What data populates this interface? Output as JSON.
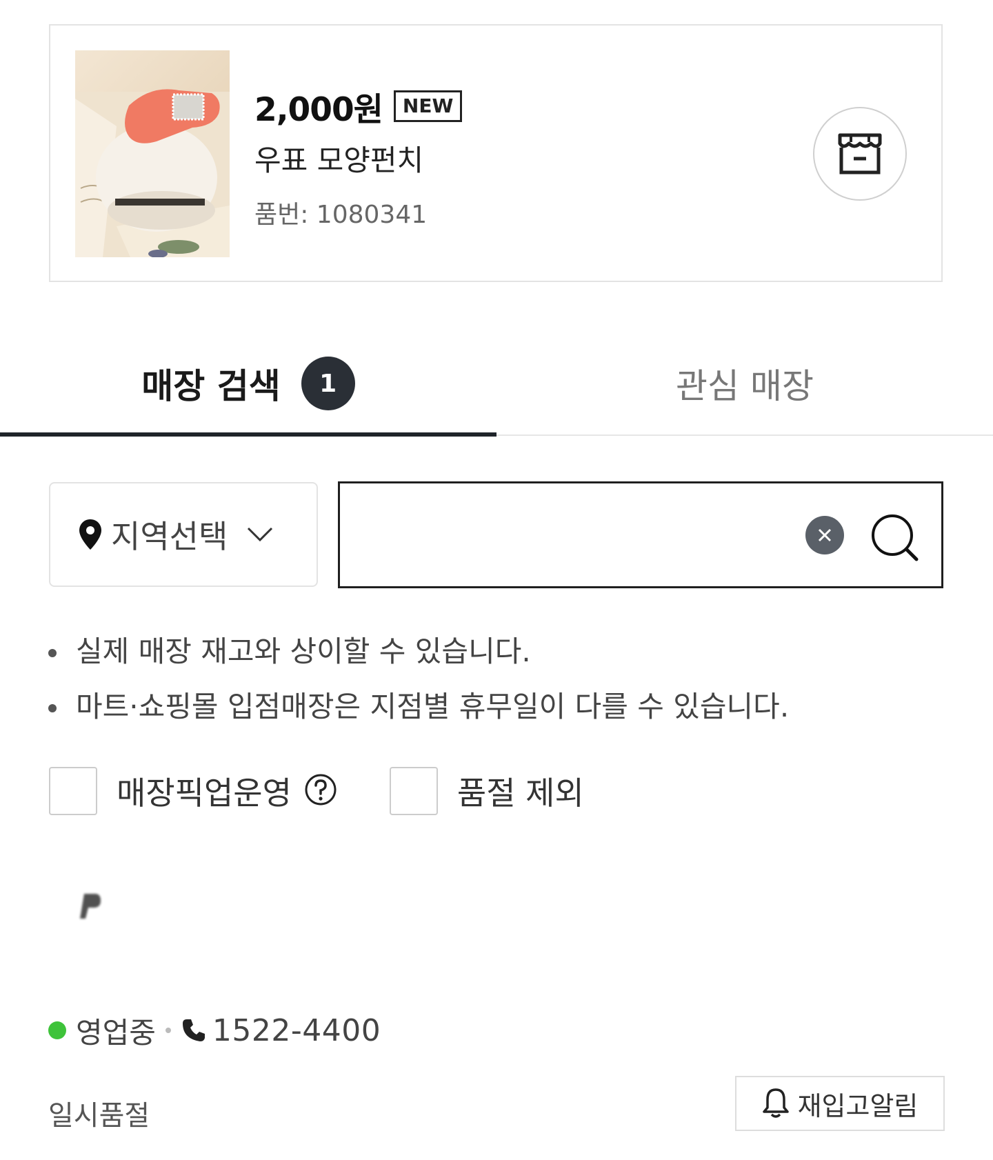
{
  "product": {
    "price": "2,000원",
    "badge": "NEW",
    "name": "우표 모양펀치",
    "code": "품번: 1080341"
  },
  "tabs": [
    {
      "label": "매장 검색",
      "count": "1",
      "active": true
    },
    {
      "label": "관심 매장",
      "active": false
    }
  ],
  "search": {
    "region_label": "지역선택",
    "query": "",
    "placeholder": ""
  },
  "notes": [
    "실제 매장 재고와 상이할 수 있습니다.",
    "마트·쇼핑몰 입점매장은 지점별 휴무일이 다를 수 있습니다."
  ],
  "filters": {
    "pickup_label": "매장픽업운영",
    "exclude_soldout_label": "품절 제외"
  },
  "store": {
    "status": "영업중",
    "phone": "1522-4400",
    "stock_status": "일시품절",
    "restock_label": "재입고알림"
  },
  "colors": {
    "accent": "#1f242a",
    "open": "#3ec33a",
    "product_punch": "#f07a63"
  }
}
